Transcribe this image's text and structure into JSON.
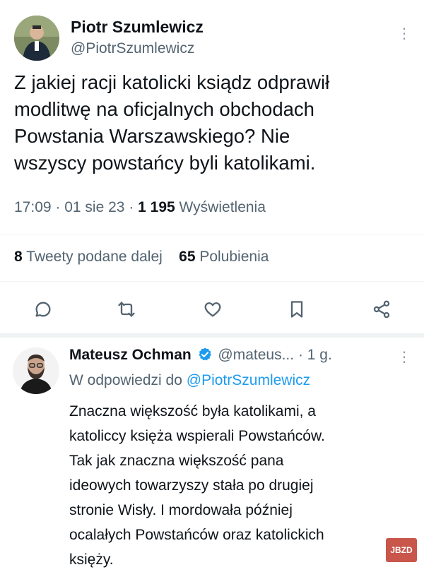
{
  "tweet": {
    "author_name": "Piotr Szumlewicz",
    "author_handle": "@PiotrSzumlewicz",
    "text_lines": [
      "Z jakiej racji katolicki ksiądz odprawił",
      "modlitwę na oficjalnych obchodach",
      "Powstania Warszawskiego? Nie",
      "wszyscy powstańcy byli katolikami."
    ],
    "time": "17:09",
    "date": "01 sie 23",
    "views_count": "1 195",
    "views_label": "Wyświetlenia",
    "retweets_count": "8",
    "retweets_label": "Tweety podane dalej",
    "likes_count": "65",
    "likes_label": "Polubienia",
    "more_icon": "⋮"
  },
  "actions": [
    "reply-icon",
    "retweet-icon",
    "like-icon",
    "bookmark-icon",
    "share-icon"
  ],
  "reply": {
    "author_name": "Mateusz Ochman",
    "author_handle": "@mateus...",
    "age": "· 1 g.",
    "in_reply_prefix": "W odpowiedzi do",
    "in_reply_handle": "@PiotrSzumlewicz",
    "text_lines": [
      "Znaczna większość była katolikami, a",
      "katoliccy księża wspierali Powstańców.",
      "Tak jak znaczna większość pana",
      "ideowych towarzyszy stała po drugiej",
      "stronie Wisły. I mordowała później",
      "ocalałych Powstańców oraz katolickich",
      "księży."
    ]
  },
  "watermark": "JBZD",
  "colors": {
    "accent": "#1d9bf0",
    "secondary_text": "#536471",
    "divider": "#eff3f4"
  }
}
